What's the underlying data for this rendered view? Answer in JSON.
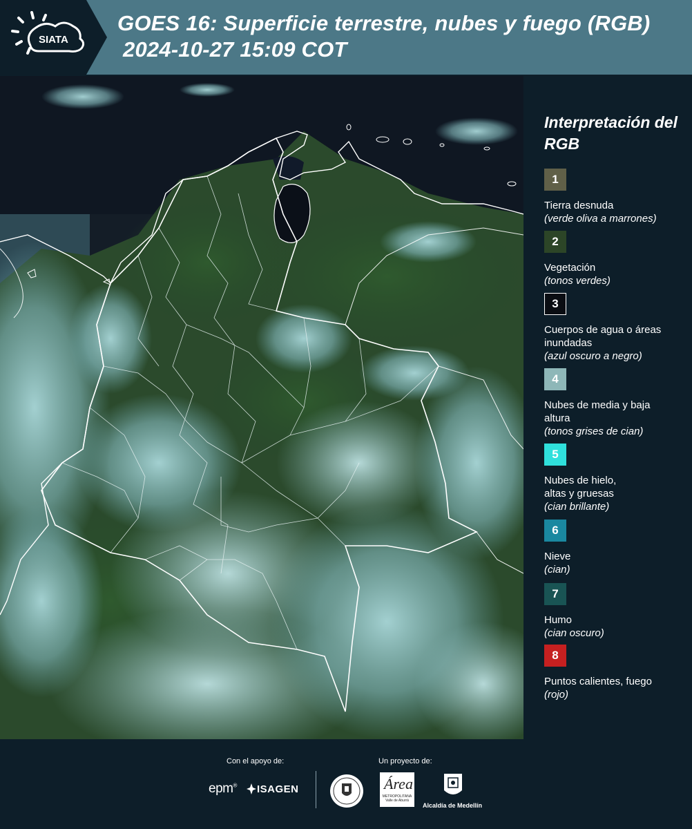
{
  "header": {
    "logo_text": "SIATA",
    "title_line1": "GOES 16: Superficie terrestre, nubes y fuego (RGB)",
    "title_line2": "2024-10-27 15:09 COT",
    "background_color": "#4c7887"
  },
  "legend": {
    "title": "Interpretación del RGB",
    "items": [
      {
        "number": "1",
        "label": "Tierra desnuda",
        "description": "(verde oliva a marrones)",
        "color": "#606048"
      },
      {
        "number": "2",
        "label": "Vegetación",
        "description": "(tonos verdes)",
        "color": "#2c4527"
      },
      {
        "number": "3",
        "label": "Cuerpos de agua o áreas inundadas",
        "description": "(azul oscuro a negro)",
        "color": "#0a0d12"
      },
      {
        "number": "4",
        "label": "Nubes de media y baja altura",
        "description": "(tonos grises de cian)",
        "color": "#8eb7b8"
      },
      {
        "number": "5",
        "label": "Nubes de hielo, altas y gruesas",
        "description": "(cian brillante)",
        "color": "#2fe0dc"
      },
      {
        "number": "6",
        "label": "Nieve",
        "description": "(cian)",
        "color": "#1a88a0"
      },
      {
        "number": "7",
        "label": "Humo",
        "description": "(cian oscuro)",
        "color": "#195454"
      },
      {
        "number": "8",
        "label": "Puntos calientes, fuego",
        "description": "(rojo)",
        "color": "#c62020"
      }
    ]
  },
  "footer": {
    "support_label": "Con el apoyo de:",
    "project_label": "Un proyecto de:",
    "sponsor_epm": "epm",
    "sponsor_isagen": "ISAGEN",
    "partner_area": "Área",
    "partner_area_sub": "METROPOLITANA Valle de Aburrá",
    "partner_alcaldia": "Alcaldía de Medellín"
  }
}
